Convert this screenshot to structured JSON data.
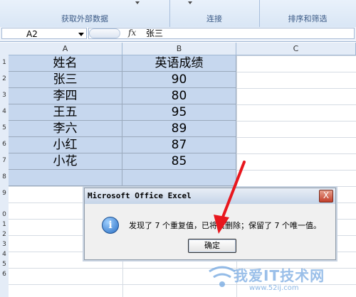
{
  "ribbon": {
    "groups": [
      {
        "label": "获取外部数据"
      },
      {
        "label": "连接"
      },
      {
        "label": "排序和筛选"
      }
    ]
  },
  "formula_bar": {
    "name_box": "A2",
    "fx_icon": "fx",
    "value": "张三"
  },
  "sheet": {
    "columns": [
      "A",
      "B",
      "C"
    ],
    "rows": [
      "1",
      "2",
      "3",
      "4",
      "5",
      "6",
      "7",
      "8",
      "9",
      "0",
      "1",
      "2",
      "3",
      "4",
      "5",
      "6"
    ],
    "header": [
      "姓名",
      "英语成绩"
    ],
    "data": [
      [
        "张三",
        "90"
      ],
      [
        "李四",
        "80"
      ],
      [
        "王五",
        "95"
      ],
      [
        "李六",
        "89"
      ],
      [
        "小红",
        "87"
      ],
      [
        "小花",
        "85"
      ]
    ],
    "selection_color": "#c6d7ee"
  },
  "dialog": {
    "title": "Microsoft Office Excel",
    "close_glyph": "X",
    "icon": "info-icon",
    "message": "发现了 7 个重复值，已将其删除；保留了 7 个唯一值。",
    "ok_label": "确定"
  },
  "annotation": {
    "arrow_color": "#e8171e"
  },
  "watermark": {
    "text": "我爱IT技术网",
    "url": "www.52ij.com"
  }
}
